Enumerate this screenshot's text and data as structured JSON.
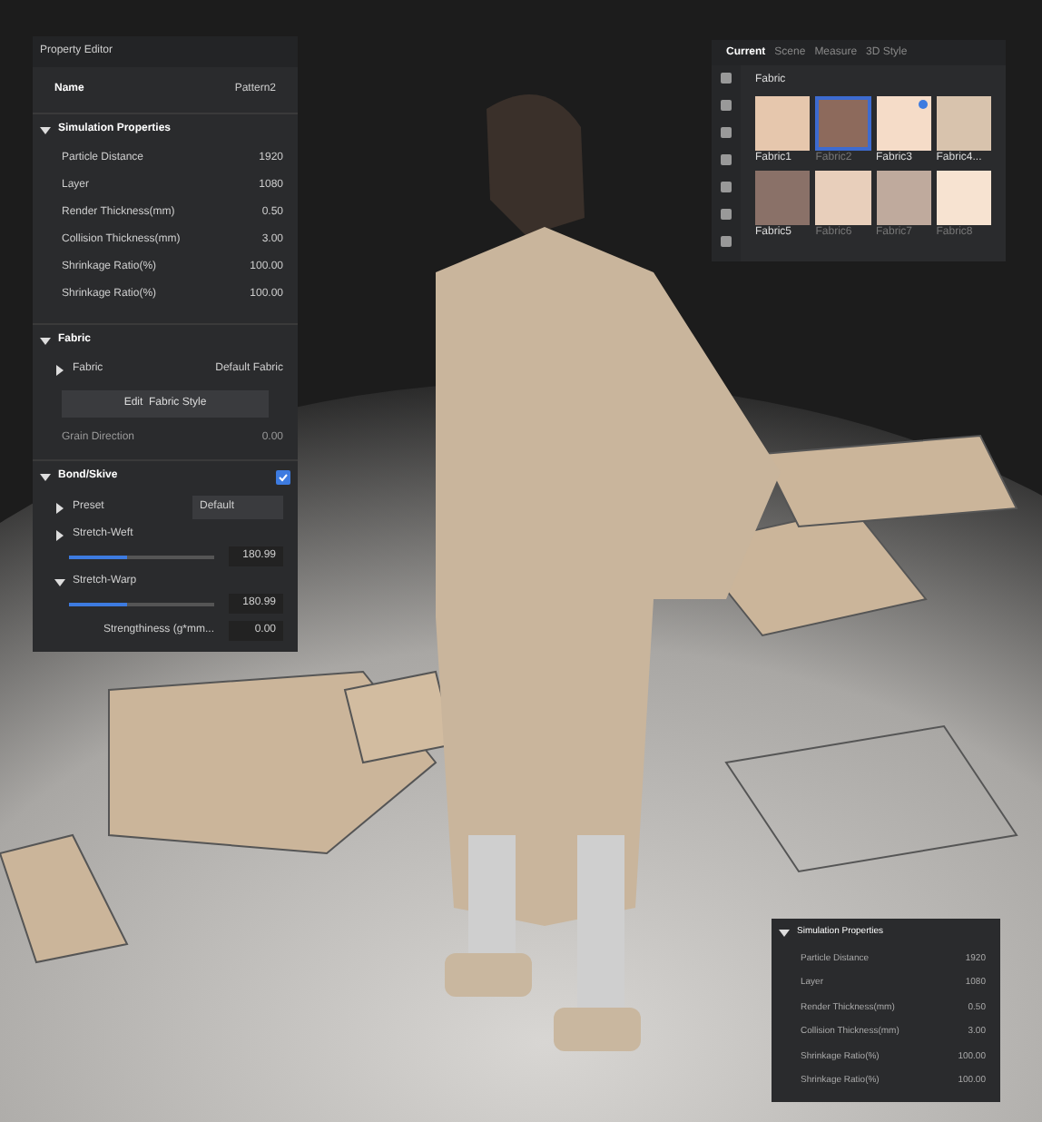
{
  "property_editor": {
    "title": "Property Editor",
    "name_label": "Name",
    "name_value": "Pattern2",
    "simulation": {
      "title": "Simulation Properties",
      "expanded": true,
      "rows": [
        {
          "label": "Particle Distance",
          "value": "1920"
        },
        {
          "label": "Layer",
          "value": "1080"
        },
        {
          "label": "Render Thickness(mm)",
          "value": "0.50"
        },
        {
          "label": "Collision Thickness(mm)",
          "value": "3.00"
        },
        {
          "label": "Shrinkage Ratio(%)",
          "value": "100.00"
        },
        {
          "label": "Shrinkage Ratio(%)",
          "value": "100.00"
        }
      ]
    },
    "fabric": {
      "title": "Fabric",
      "expanded": true,
      "fabric_label": "Fabric",
      "fabric_value": "Default Fabric",
      "edit_button": "Edit  Fabric Style",
      "grain_label": "Grain Direction",
      "grain_value": "0.00"
    },
    "bond": {
      "title": "Bond/Skive",
      "expanded": true,
      "checked": true,
      "preset_label": "Preset",
      "preset_value": "Default",
      "sliders": [
        {
          "label": "Stretch-Weft",
          "expanded": false,
          "level": 0.4,
          "value": "180.99"
        },
        {
          "label": "Stretch-Warp",
          "expanded": true,
          "level": 0.4,
          "value": "180.99"
        }
      ],
      "stiffness_label": "Strengthiness  (g*mm...",
      "stiffness_value": "0.00"
    }
  },
  "library": {
    "tabs": [
      {
        "label": "Current",
        "selected": true
      },
      {
        "label": "Scene",
        "selected": false
      },
      {
        "label": "Measure",
        "selected": false
      },
      {
        "label": "3D Style",
        "selected": false
      }
    ],
    "section": "Fabric",
    "swatches": [
      {
        "label": "Fabric1",
        "color": "#e6c7ad",
        "selected": false,
        "checked": false,
        "dimmed": false
      },
      {
        "label": "Fabric2",
        "color": "#8d6a5c",
        "selected": true,
        "checked": false,
        "dimmed": true
      },
      {
        "label": "Fabric3",
        "color": "#f5dcc8",
        "selected": false,
        "checked": true,
        "dimmed": false
      },
      {
        "label": "Fabric4...",
        "color": "#d8c3ad",
        "selected": false,
        "checked": false,
        "dimmed": false
      },
      {
        "label": "Fabric5",
        "color": "#8a7168",
        "selected": false,
        "checked": false,
        "dimmed": false
      },
      {
        "label": "Fabric6",
        "color": "#e8cfbb",
        "selected": false,
        "checked": false,
        "dimmed": true
      },
      {
        "label": "Fabric7",
        "color": "#bfaa9d",
        "selected": false,
        "checked": false,
        "dimmed": true
      },
      {
        "label": "Fabric8",
        "color": "#f7e3d1",
        "selected": false,
        "checked": false,
        "dimmed": true
      }
    ]
  },
  "sim_panel": {
    "title": "Simulation Properties",
    "expanded": true,
    "rows": [
      {
        "label": "Particle Distance",
        "value": "1920"
      },
      {
        "label": "Layer",
        "value": "1080"
      },
      {
        "label": "Render Thickness(mm)",
        "value": "0.50"
      },
      {
        "label": "Collision Thickness(mm)",
        "value": "3.00"
      },
      {
        "label": "Shrinkage Ratio(%)",
        "value": "100.00"
      },
      {
        "label": "Shrinkage Ratio(%)",
        "value": "100.00"
      }
    ]
  }
}
